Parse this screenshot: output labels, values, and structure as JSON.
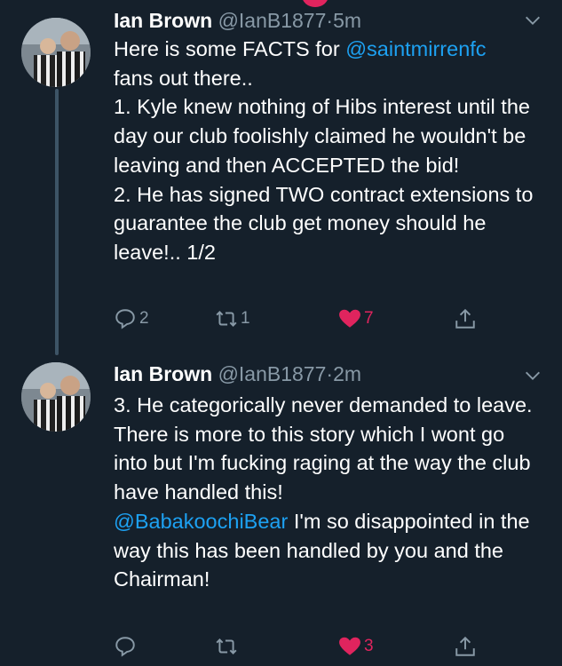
{
  "tweets": [
    {
      "author_name": "Ian Brown",
      "handle": "@IanB1877",
      "separator": "·",
      "time": "5m",
      "text_1": "Here is some FACTS for ",
      "mention_1": "@saintmirrenfc",
      "text_2": "\nfans out there..\n1. Kyle knew nothing of Hibs interest until the day our club foolishly claimed he wouldn't be leaving and then ACCEPTED the bid!\n2. He has signed TWO contract extensions to guarantee the club get money should he leave!.. 1/2",
      "reply_count": "2",
      "retweet_count": "1",
      "like_count": "7",
      "liked": true
    },
    {
      "author_name": "Ian Brown",
      "handle": "@IanB1877",
      "separator": "·",
      "time": "2m",
      "text_1": "3. He categorically never demanded to leave.\nThere is more to this story which I wont go into but I'm fucking raging at the way the club have handled this!\n",
      "mention_1": "@BabakoochiBear",
      "text_2": " I'm so disappointed in the way this has been handled by you and the Chairman!",
      "reply_count": "",
      "retweet_count": "",
      "like_count": "3",
      "liked": true
    }
  ],
  "colors": {
    "background": "#15202b",
    "text": "#ffffff",
    "secondary": "#8899a6",
    "link": "#1da1f2",
    "like": "#e0245e"
  },
  "icons": [
    "reply-icon",
    "retweet-icon",
    "like-icon",
    "share-icon",
    "chevron-down-icon"
  ]
}
